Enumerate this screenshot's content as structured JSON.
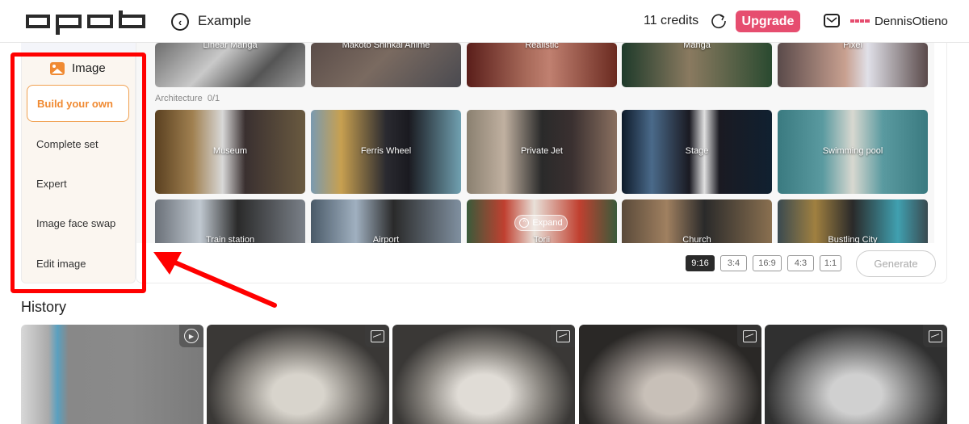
{
  "header": {
    "logo": "apob",
    "back_icon": "chevron-left-circle-icon",
    "page_title": "Example",
    "credits": "11 credits",
    "refresh_icon": "refresh-icon",
    "upgrade_label": "Upgrade",
    "mail_icon": "mail-icon",
    "user_logo": "apob",
    "username": "DennisOtieno",
    "accent_color": "#e64d6f"
  },
  "sidebar": {
    "section_title": "Image",
    "section_icon": "image-icon",
    "items": [
      {
        "label": "Build your own",
        "active": true
      },
      {
        "label": "Complete set",
        "active": false
      },
      {
        "label": "Expert",
        "active": false
      },
      {
        "label": "Image face swap",
        "active": false
      },
      {
        "label": "Edit image",
        "active": false
      }
    ],
    "accent_color": "#f08a32"
  },
  "styles": {
    "cards": [
      {
        "label": "Linear Manga"
      },
      {
        "label": "Makoto Shinkai Anime"
      },
      {
        "label": "Realistic"
      },
      {
        "label": "Manga"
      },
      {
        "label": "Pixel"
      }
    ]
  },
  "architecture": {
    "section_label": "Architecture",
    "count": "0/1",
    "cards": [
      {
        "label": "Museum"
      },
      {
        "label": "Ferris Wheel"
      },
      {
        "label": "Private Jet"
      },
      {
        "label": "Stage"
      },
      {
        "label": "Swimming pool"
      },
      {
        "label": "Train station"
      },
      {
        "label": "Airport"
      },
      {
        "label": "Torii"
      },
      {
        "label": "Church"
      },
      {
        "label": "Bustling City"
      }
    ],
    "expand_label": "Expand"
  },
  "toolbar": {
    "ratios": [
      {
        "label": "9:16",
        "active": true
      },
      {
        "label": "3:4",
        "active": false
      },
      {
        "label": "16:9",
        "active": false
      },
      {
        "label": "4:3",
        "active": false
      },
      {
        "label": "1:1",
        "active": false
      }
    ],
    "generate_label": "Generate"
  },
  "history": {
    "title": "History",
    "items": [
      {
        "type": "video",
        "icon": "play-icon"
      },
      {
        "type": "image",
        "icon": "image-icon"
      },
      {
        "type": "image",
        "icon": "image-icon"
      },
      {
        "type": "image",
        "icon": "image-icon"
      },
      {
        "type": "image",
        "icon": "image-icon"
      }
    ]
  },
  "annotation": {
    "highlight_color": "#ff0000"
  }
}
